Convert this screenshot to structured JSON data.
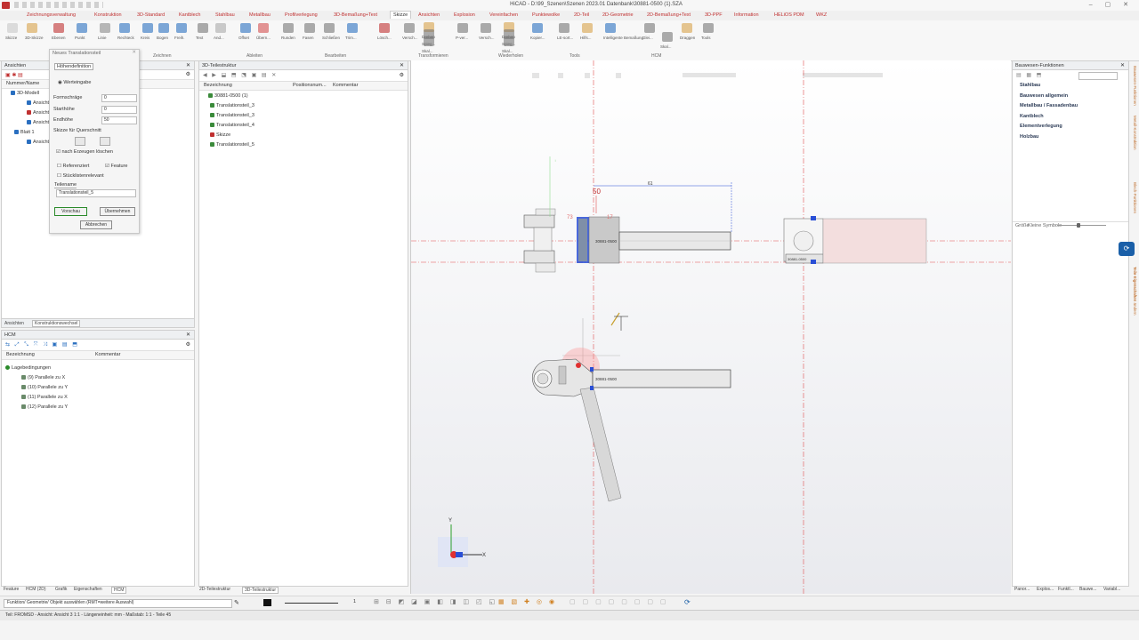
{
  "window": {
    "title": "HiCAD - D:\\99_Szenen\\Szenen 2023.01 Datenbank\\30881-0500 (1).SZA"
  },
  "menu": {
    "items": [
      "Zeichnungsverwaltung",
      "Konstruktion",
      "3D-Standard",
      "Kantblech",
      "Stahlbau",
      "Metallbau",
      "Profilverlegung",
      "3D-Bemaßung+Text",
      "Skizze",
      "Ansichten",
      "Explosion",
      "Vereinfachen",
      "Punktewolke",
      "2D-Teil",
      "2D-Geometrie",
      "2D-Bemaßung+Text",
      "3D-PPF",
      "Information",
      "HELiOS PDM",
      "WKZ"
    ],
    "active": "Skizze"
  },
  "ribbon": {
    "buttons": [
      "Skizze",
      "3D-Skizze",
      "Ebenen",
      "Punkt",
      "Linie",
      "Rechteck",
      "Kreis",
      "Bogen",
      "Freih.",
      "Text",
      "And...",
      "Offset",
      "Übern...",
      "Runden",
      "Fasen",
      "Schließen",
      "Trim...",
      "Lösch...",
      "Versch...",
      "Drehen",
      "Spieg...",
      "Skal...",
      "P-ver...",
      "Versch...",
      "Drehen",
      "Spieg...",
      "Skal...",
      "Kopier...",
      "LE-sort...",
      "Hilfs...",
      "Intelligente Bemaßung",
      "Glei...",
      "Skal...",
      "Draggen",
      "Tools"
    ],
    "groups": [
      "Zeichnen",
      "Ableiten",
      "Bearbeiten",
      "Transformieren",
      "Wiederholen",
      "Tools",
      "HCM"
    ]
  },
  "left_panel": {
    "title": "Ansichten",
    "columns": [
      "Nummer/Name"
    ],
    "tree": [
      {
        "label": "3D-Modell",
        "red": false
      },
      {
        "label": "Ansicht",
        "red": false
      },
      {
        "label": "Ansicht",
        "red": true
      },
      {
        "label": "Ansicht",
        "red": false
      },
      {
        "label": "Blatt 1",
        "red": false
      },
      {
        "label": "Ansicht",
        "red": false
      }
    ],
    "tabs": [
      "Ansichten",
      "Konstruktionswechsel"
    ]
  },
  "dialog": {
    "title": "Neues Translationsteil",
    "sections": {
      "hoehe": "Höhendefinition",
      "skizze": "Skizze für Querschnitt",
      "teilename": "Teilename"
    },
    "wertangabe": "Werteingabe",
    "fields": [
      {
        "label": "Formschräge",
        "value": "0"
      },
      {
        "label": "Starthöhe",
        "value": "0"
      },
      {
        "label": "Endhöhe",
        "value": "50"
      }
    ],
    "checkboxes": {
      "nach_erzeugen": "nach Erzeugen löschen",
      "referenziert": "Referenziert",
      "feature": "Feature",
      "stuecklisten": "Stücklistenrelevant"
    },
    "part_name": "Translationsteil_5",
    "buttons": {
      "vorschau": "Vorschau",
      "uebernehmen": "Übernehmen",
      "abbrechen": "Abbrechen"
    }
  },
  "hcm_panel": {
    "title": "HCM",
    "columns": [
      "Bezeichnung",
      "Kommentar"
    ],
    "root": "Lagebedingungen",
    "items": [
      "(9) Parallele zu X",
      "(10) Parallele zu Y",
      "(11) Parallele zu X",
      "(12) Parallele zu Y"
    ]
  },
  "part_tree": {
    "title": "3D-Teilestruktur",
    "columns": [
      "Bezeichnung",
      "Positionsnum...",
      "Kommentar"
    ],
    "items": [
      {
        "label": "30881-0500 (1)",
        "red": false
      },
      {
        "label": "Translationsteil_3",
        "red": false
      },
      {
        "label": "Translationsteil_3",
        "red": false
      },
      {
        "label": "Translationsteil_4",
        "red": false
      },
      {
        "label": "Skizze",
        "red": true
      },
      {
        "label": "Translationsteil_5",
        "red": false
      }
    ]
  },
  "right_panel": {
    "title": "Bauwesen-Funktionen",
    "items": [
      "Stahlbau",
      "Bauwesen allgemein",
      "Metallbau / Fassadenbau",
      "Kantblech",
      "Elementverlegung",
      "Holzbau"
    ],
    "size_label": "Größe",
    "size_value": "Kleine Symbole",
    "side_tabs": [
      "Bauwesen-Funktionen",
      "Metall-Konstruktion",
      "Blech-Funktionen",
      "Teile-Eigenschaften",
      "Teile-Eigenschaften ändern"
    ]
  },
  "viewport": {
    "dim_61": "61",
    "dim_50": "50",
    "dim_73": "73",
    "dim_17": "17",
    "label_part": "30881-0500",
    "axis_x": "X",
    "axis_y": "Y"
  },
  "bottom_tabs": {
    "left": [
      "Feature",
      "HCM (2D)",
      "Grafik",
      "Eigenschaften",
      "HCM"
    ],
    "mid": [
      "2D-Teilestruktur",
      "3D-Teilestruktur"
    ],
    "right": [
      "Panor...",
      "Explos...",
      "Funktl...",
      "Bauwe...",
      "Variabl..."
    ]
  },
  "toolbar_bottom": {
    "page": "1"
  },
  "status": {
    "prompt": "Funktion/ Geometrie/ Objekt auswählen (RMT=weitere Auswahl)",
    "info": "Teil: FROMSD - Ansicht: Ansicht 3 1:1 - Längeneinheit: mm - Maßstab: 1:1 - Teile 45"
  },
  "colors": {
    "accent": "#c03030",
    "select": "#2a4fd6",
    "bar": "#1a3fbf"
  }
}
